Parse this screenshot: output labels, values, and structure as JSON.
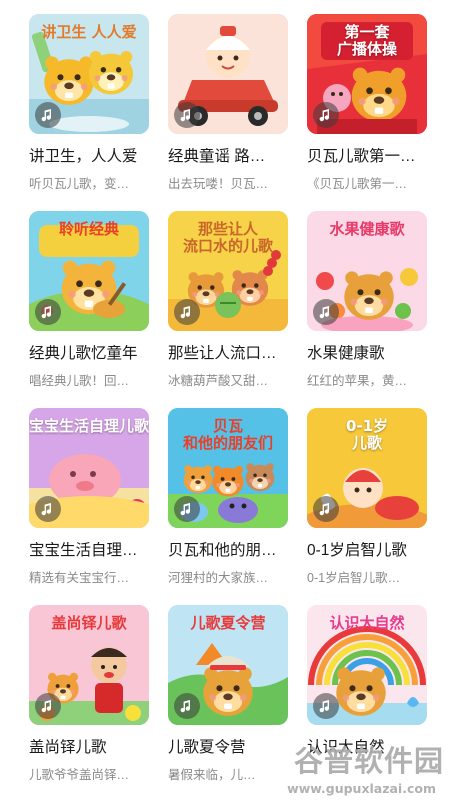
{
  "cards": [
    {
      "title": "讲卫生，人人爱",
      "subtitle": "听贝瓦儿歌，变…",
      "thumb_text": "讲卫生 人人爱",
      "bg": "#c7e6ee",
      "accent": "#f5b92a",
      "icon": "beaver-hygiene-icon"
    },
    {
      "title": "经典童谣 路…",
      "subtitle": "出去玩喽！贝瓦…",
      "thumb_text": "",
      "bg": "#f6c7b8",
      "accent": "#e24a3b",
      "icon": "race-car-kid-icon"
    },
    {
      "title": "贝瓦儿歌第一…",
      "subtitle": "《贝瓦儿歌第一…",
      "thumb_text": "第一套\n广播体操",
      "bg": "#e8303a",
      "accent": "#ffd93a",
      "icon": "exercise-beaver-icon"
    },
    {
      "title": "经典儿歌忆童年",
      "subtitle": "唱经典儿歌！回…",
      "thumb_text": "聆听经典",
      "bg": "#f4cf3e",
      "accent": "#e8452f",
      "icon": "guitar-beaver-icon"
    },
    {
      "title": "那些让人流口…",
      "subtitle": "冰糖葫芦酸又甜…",
      "thumb_text": "那些让人\n流口水的儿歌",
      "bg": "#f7d34a",
      "accent": "#c98a3e",
      "icon": "eating-beavers-icon"
    },
    {
      "title": "水果健康歌",
      "subtitle": "红红的苹果，黄…",
      "thumb_text": "水果健康歌",
      "bg": "#f7c2d6",
      "accent": "#6cc24a",
      "icon": "fruit-beaver-icon"
    },
    {
      "title": "宝宝生活自理…",
      "subtitle": "精选有关宝宝行…",
      "thumb_text": "宝宝生活自理儿歌",
      "bg": "#d7a6e8",
      "accent": "#f8a6b8",
      "icon": "sleeping-baby-icon"
    },
    {
      "title": "贝瓦和他的朋…",
      "subtitle": "河狸村的大家族…",
      "thumb_text": "贝瓦\n和他的朋友们",
      "bg": "#55c1e6",
      "accent": "#f28a2a",
      "icon": "friends-group-icon"
    },
    {
      "title": "0-1岁启智儿歌",
      "subtitle": "0-1岁启智儿歌…",
      "thumb_text": "0-1岁\n儿歌",
      "bg": "#f7c83a",
      "accent": "#f08a2a",
      "icon": "crawling-baby-icon"
    },
    {
      "title": "盖尚铎儿歌",
      "subtitle": "儿歌爷爷盖尚铎…",
      "thumb_text": "盖尚铎儿歌",
      "bg": "#f9c6d6",
      "accent": "#7fc24a",
      "icon": "grandpa-singer-icon"
    },
    {
      "title": "儿歌夏令营",
      "subtitle": "暑假来临，儿…",
      "thumb_text": "儿歌夏令营",
      "bg": "#bfe4f4",
      "accent": "#3aa648",
      "icon": "summer-camp-icon"
    },
    {
      "title": "认识大自然",
      "subtitle": "",
      "thumb_text": "认识大自然",
      "bg": "#fbe6ee",
      "accent": "#e83a5a",
      "icon": "rainbow-beaver-icon"
    }
  ],
  "watermark": {
    "main": "谷普软件园",
    "sub": "www.gupuxlazai.com"
  }
}
